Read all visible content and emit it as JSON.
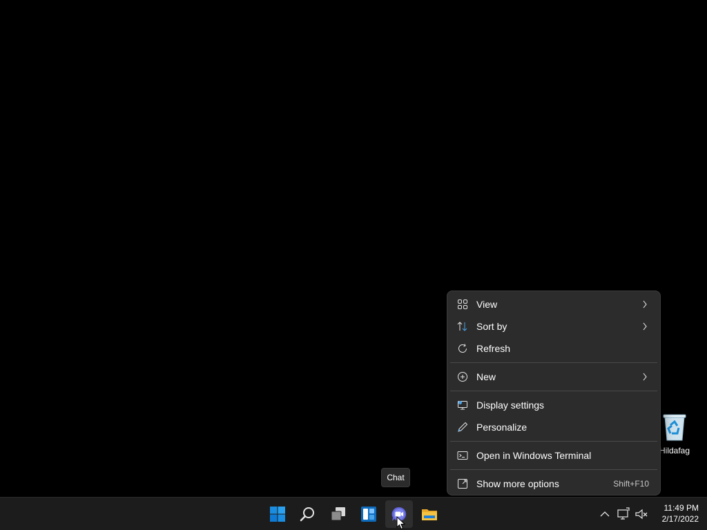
{
  "desktop": {
    "background": "#000000",
    "icons": [
      {
        "label": "Hildafag",
        "icon": "recycle-bin-icon"
      }
    ]
  },
  "context_menu": {
    "items": [
      {
        "label": "View",
        "icon": "view-grid-icon",
        "has_submenu": true
      },
      {
        "label": "Sort by",
        "icon": "sort-icon",
        "has_submenu": true
      },
      {
        "label": "Refresh",
        "icon": "refresh-icon",
        "has_submenu": false
      },
      {
        "label": "New",
        "icon": "new-plus-icon",
        "has_submenu": true
      },
      {
        "label": "Display settings",
        "icon": "display-settings-icon",
        "has_submenu": false
      },
      {
        "label": "Personalize",
        "icon": "personalize-pen-icon",
        "has_submenu": false
      },
      {
        "label": "Open in Windows Terminal",
        "icon": "terminal-icon",
        "has_submenu": false
      },
      {
        "label": "Show more options",
        "icon": "more-options-icon",
        "has_submenu": false,
        "shortcut": "Shift+F10"
      }
    ]
  },
  "tooltip": {
    "text": "Chat"
  },
  "taskbar": {
    "apps": [
      {
        "name": "Start",
        "icon": "windows-start-icon"
      },
      {
        "name": "Search",
        "icon": "search-icon"
      },
      {
        "name": "Task View",
        "icon": "task-view-icon"
      },
      {
        "name": "Widgets",
        "icon": "widgets-icon"
      },
      {
        "name": "Chat",
        "icon": "chat-icon"
      },
      {
        "name": "File Explorer",
        "icon": "file-explorer-icon"
      }
    ],
    "tray": {
      "icons": [
        "chevron-up-icon",
        "network-icon",
        "volume-muted-icon"
      ],
      "time": "11:49 PM",
      "date": "2/17/2022"
    }
  },
  "colors": {
    "menu_bg": "#2c2c2c",
    "taskbar_bg": "#1c1c1c",
    "accent_blue": "#0078d4",
    "chat_purple": "#7b83eb",
    "folder_yellow": "#f5c342"
  }
}
